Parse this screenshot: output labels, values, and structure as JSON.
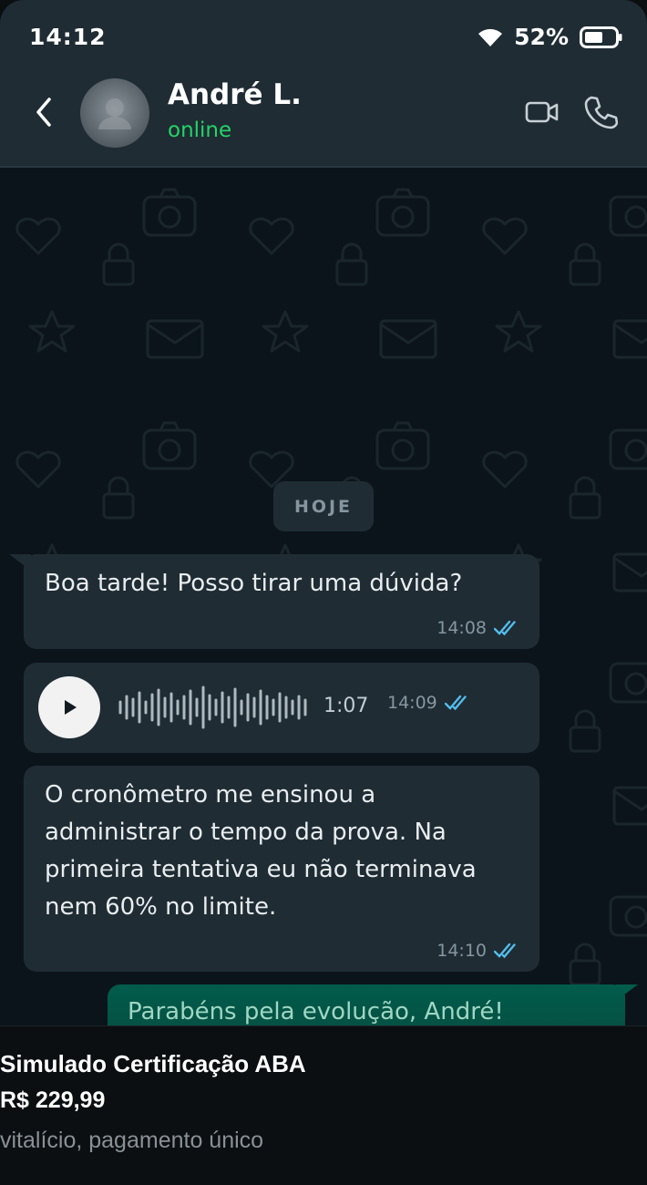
{
  "status_bar": {
    "time": "14:12",
    "battery": "52%"
  },
  "header": {
    "contact_name": "André L.",
    "contact_status": "online"
  },
  "chat": {
    "day_label": "HOJE",
    "messages": [
      {
        "type": "text",
        "direction": "in",
        "text": "Boa tarde! Posso tirar uma dúvida?",
        "time": "14:08",
        "status": "read"
      },
      {
        "type": "audio",
        "direction": "in",
        "duration": "1:07",
        "time": "14:09",
        "status": "read"
      },
      {
        "type": "text",
        "direction": "in",
        "text": "O cronômetro me ensinou a administrar o tempo da prova. Na primeira tentativa eu não terminava nem 60% no limite.",
        "time": "14:10",
        "status": "read"
      },
      {
        "type": "text",
        "direction": "out",
        "text": "Parabéns pela evolução, André!"
      }
    ]
  },
  "product": {
    "title": "Simulado Certificação ABA",
    "price": "R$ 229,99",
    "terms": "vitalício, pagamento único"
  },
  "colors": {
    "header_bg": "#1f2c34",
    "chat_bg": "#0b141a",
    "bubble_in": "#1f2c34",
    "bubble_out": "#005c4b",
    "online": "#25d366",
    "read_ticks": "#53bdeb"
  },
  "icons": [
    "wifi-icon",
    "battery-icon",
    "back-icon",
    "video-call-icon",
    "phone-call-icon",
    "play-icon",
    "double-check-icon"
  ]
}
